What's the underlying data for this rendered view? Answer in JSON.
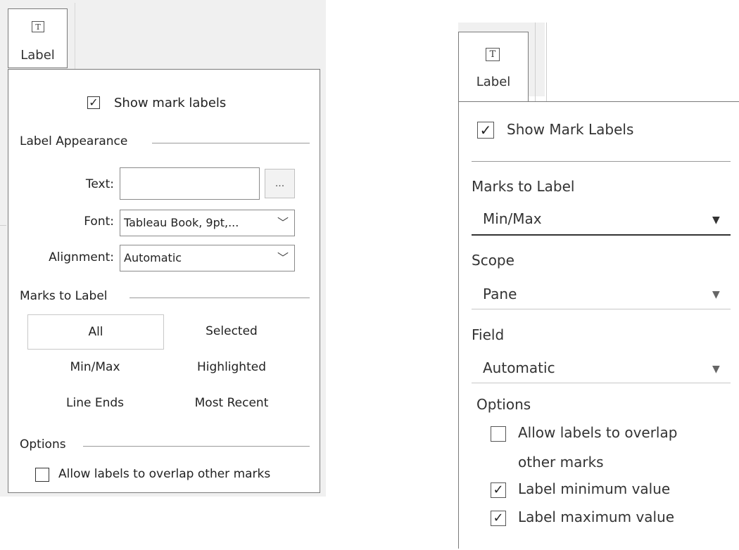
{
  "left_panel": {
    "tab": {
      "icon": "text-icon",
      "icon_glyph": "T",
      "label": "Label"
    },
    "show_mark_labels": {
      "label": "Show mark labels",
      "checked": true,
      "check_glyph": "✓"
    },
    "label_appearance": {
      "title": "Label Appearance",
      "text_label": "Text:",
      "text_value": "",
      "text_button": "...",
      "font_label": "Font:",
      "font_value": "Tableau Book, 9pt,...",
      "alignment_label": "Alignment:",
      "alignment_value": "Automatic",
      "chevron_glyph": "﹀"
    },
    "marks_to_label": {
      "title": "Marks to Label",
      "options": [
        "All",
        "Selected",
        "Min/Max",
        "Highlighted",
        "Line Ends",
        "Most Recent"
      ],
      "selected": "All"
    },
    "options": {
      "title": "Options",
      "allow_overlap": {
        "label": "Allow labels to overlap other marks",
        "checked": false
      }
    }
  },
  "right_panel": {
    "tab": {
      "icon": "text-icon",
      "icon_glyph": "T",
      "label": "Label"
    },
    "show_mark_labels": {
      "label": "Show Mark Labels",
      "checked": true,
      "check_glyph": "✓"
    },
    "marks_to_label": {
      "title": "Marks to Label",
      "value": "Min/Max",
      "arrow_glyph": "▼"
    },
    "scope": {
      "title": "Scope",
      "value": "Pane",
      "arrow_glyph": "▼"
    },
    "field": {
      "title": "Field",
      "value": "Automatic",
      "arrow_glyph": "▼"
    },
    "options": {
      "title": "Options",
      "allow_overlap": {
        "line1": "Allow labels to overlap",
        "line2": "other marks",
        "checked": false
      },
      "label_min": {
        "label": "Label minimum value",
        "checked": true
      },
      "label_max": {
        "label": "Label maximum value",
        "checked": true
      }
    }
  },
  "colors": {
    "border": "#7a7a7a",
    "toolbar_bg": "#f0f0f0",
    "underline_active": "#333333",
    "underline": "#c8c8c8"
  }
}
